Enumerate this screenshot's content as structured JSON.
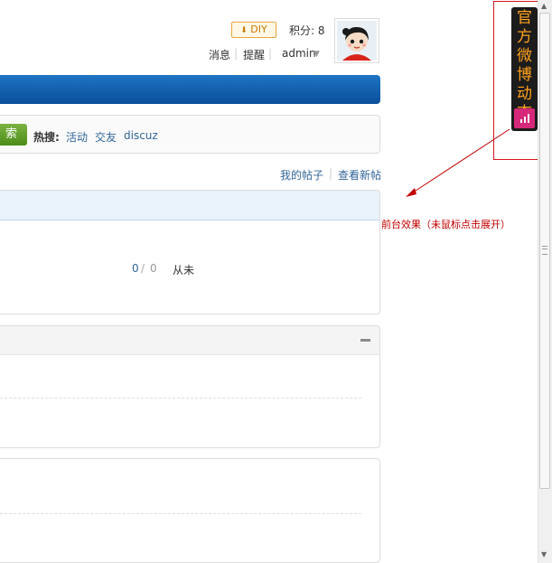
{
  "user": {
    "diy_label": "DIY",
    "credits_label": "积分: 8",
    "messages_label": "消息",
    "reminders_label": "提醒",
    "username": "admin",
    "separator": "|"
  },
  "search": {
    "button_label": "索",
    "hot_label": "热搜:",
    "hot_terms": [
      "活动",
      "交友",
      "discuz"
    ]
  },
  "links": {
    "my_posts": "我的帖子",
    "new_posts": "查看新帖",
    "separator": "|"
  },
  "forum_stats": {
    "today": "0",
    "slash": "/",
    "total": "0",
    "from_label": "从未"
  },
  "weibo_widget": {
    "label": "官方微博动态",
    "tab_color": "#1c1c1c",
    "text_color": "#ffa21a",
    "signal_icon": "signal-icon"
  },
  "annotation": {
    "caption": "前台效果（未鼠标点击展开）",
    "color": "#c00000"
  },
  "colors": {
    "nav_blue": "#0a4f9b",
    "search_green": "#5a9a22",
    "link_blue": "#336699"
  }
}
